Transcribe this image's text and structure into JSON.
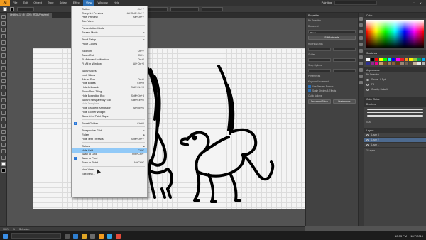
{
  "menubar": {
    "app": "Ai",
    "items": [
      "File",
      "Edit",
      "Object",
      "Type",
      "Select",
      "Effect",
      "View",
      "Window",
      "Help"
    ],
    "active": "View",
    "workspace": "Painting"
  },
  "document_tab": "Untitled-1* @ 100% (RGB/Preview)",
  "view_menu": {
    "entries": [
      {
        "label": "Outline",
        "shortcut": "Ctrl+Y"
      },
      {
        "label": "Overprint Preview",
        "shortcut": "Alt+Shift+Ctrl+Y"
      },
      {
        "label": "Pixel Preview",
        "shortcut": "Alt+Ctrl+Y"
      },
      {
        "label": "Trim View"
      },
      {
        "sep": true
      },
      {
        "label": "Presentation Mode"
      },
      {
        "label": "Screen Mode",
        "submenu": true
      },
      {
        "sep": true
      },
      {
        "label": "Proof Setup",
        "submenu": true
      },
      {
        "label": "Proof Colors"
      },
      {
        "sep": true
      },
      {
        "label": "Zoom In",
        "shortcut": "Ctrl++"
      },
      {
        "label": "Zoom Out",
        "shortcut": "Ctrl+-"
      },
      {
        "label": "Fit Artboard in Window",
        "shortcut": "Ctrl+0"
      },
      {
        "label": "Fit All in Window",
        "shortcut": "Alt+Ctrl+0"
      },
      {
        "sep": true
      },
      {
        "label": "Show Slices"
      },
      {
        "label": "Lock Slices"
      },
      {
        "label": "Actual Size",
        "shortcut": "Ctrl+1"
      },
      {
        "label": "Hide Edges",
        "shortcut": "Ctrl+H"
      },
      {
        "label": "Hide Artboards",
        "shortcut": "Shift+Ctrl+H"
      },
      {
        "label": "Show Print Tiling"
      },
      {
        "label": "Hide Bounding Box",
        "shortcut": "Shift+Ctrl+B"
      },
      {
        "label": "Show Transparency Grid",
        "shortcut": "Shift+Ctrl+D"
      },
      {
        "label": "Hide Template",
        "disabled": true
      },
      {
        "label": "Hide Gradient Annotator",
        "shortcut": "Alt+Ctrl+G"
      },
      {
        "label": "Hide Corner Widget"
      },
      {
        "label": "Show Live Paint Gaps"
      },
      {
        "sep": true
      },
      {
        "label": "Smart Guides",
        "shortcut": "Ctrl+U",
        "checked": true
      },
      {
        "sep": true
      },
      {
        "label": "Perspective Grid",
        "submenu": true
      },
      {
        "label": "Rulers",
        "submenu": true
      },
      {
        "label": "Hide Text Threads",
        "shortcut": "Shift+Ctrl+Y"
      },
      {
        "sep": true
      },
      {
        "label": "Guides",
        "submenu": true
      },
      {
        "label": "Hide Grid",
        "shortcut": "Ctrl+\"",
        "highlighted": true
      },
      {
        "label": "Snap to Grid",
        "shortcut": "Shift+Ctrl+\""
      },
      {
        "label": "Snap to Pixel",
        "checked": true
      },
      {
        "label": "Snap to Point",
        "shortcut": "Alt+Ctrl+\""
      },
      {
        "sep": true
      },
      {
        "label": "New View..."
      },
      {
        "label": "Edit View..."
      }
    ]
  },
  "properties": {
    "title": "Properties",
    "no_selection": "No Selection",
    "document_label": "Document",
    "units": "Pixels",
    "artboard_button": "Edit Artboards",
    "rulers_label": "Rulers & Grids",
    "guides_label": "Guides",
    "snap_label": "Snap Options",
    "preferences_label": "Preferences",
    "keyboard_increment": "Keyboard Increment:",
    "use_preview_bounds": "Use Preview Bounds",
    "scale_strokes": "Scale Strokes & Effects",
    "quick_actions": "Quick Actions",
    "doc_setup_button": "Document Setup",
    "prefs_button": "Preferences"
  },
  "right_panels": {
    "color_title": "Color",
    "swatches_title": "Swatches",
    "appearance_title": "Appearance",
    "appearance_rows": [
      "No Selection",
      "Stroke",
      "Fill",
      "Opacity: Default"
    ],
    "stroke_weight": "0.5 pt",
    "color_guide_title": "Color Guide",
    "brushes_title": "Brushes",
    "brush_size": "5.00",
    "layers_title": "Layers",
    "layers": [
      "Layer 3",
      "Layer 2",
      "Layer 1"
    ],
    "layer_count": "3 Layers"
  },
  "status": {
    "zoom": "100%",
    "artboard_num": "1",
    "tool": "Selection"
  },
  "taskbar": {
    "time": "10:33 PM",
    "date": "12/7/2019"
  },
  "colors": {
    "accent": "#2b6fb5",
    "menu_highlight": "#91c9f7",
    "app_orange": "#f29c1f"
  },
  "icons": [
    "search-icon",
    "windows-logo-icon",
    "chevron-right-icon",
    "check-icon",
    "eye-icon"
  ]
}
